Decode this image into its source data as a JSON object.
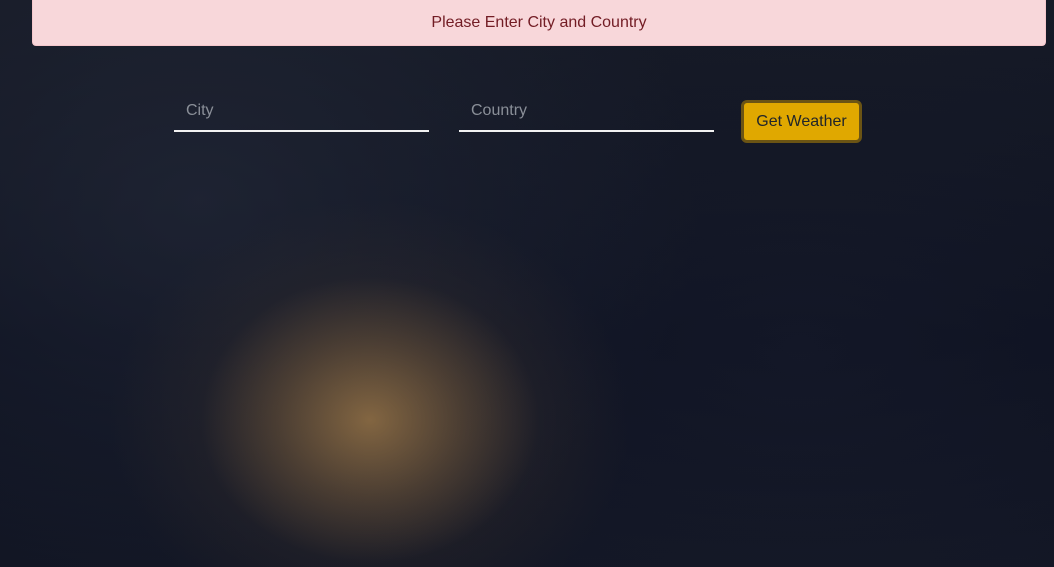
{
  "alert": {
    "message": "Please Enter City and Country",
    "background_color": "#f8d7da",
    "text_color": "#721c24"
  },
  "form": {
    "city": {
      "placeholder": "City",
      "value": ""
    },
    "country": {
      "placeholder": "Country",
      "value": ""
    },
    "submit_label": "Get Weather",
    "submit_color": "#e0a800"
  }
}
